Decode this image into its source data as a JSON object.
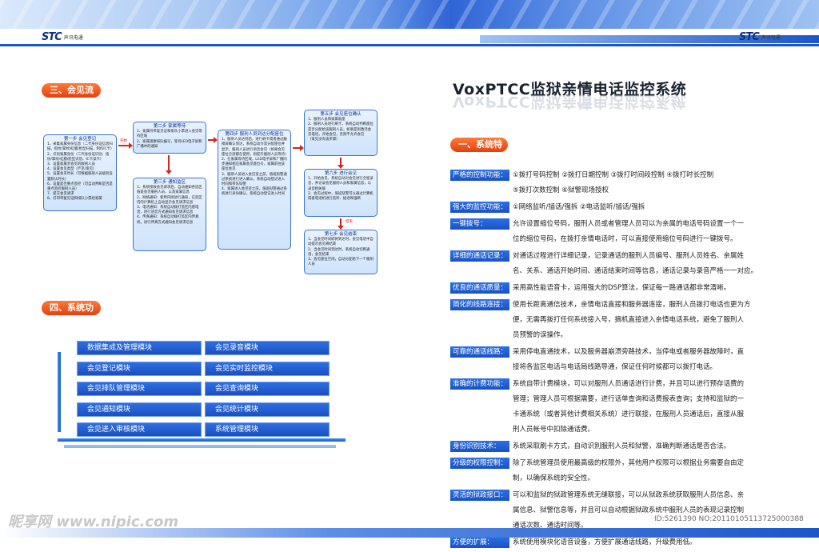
{
  "brand": {
    "logo_mark": "STC",
    "logo_text": "声讯电通"
  },
  "left": {
    "section3_title": "三、会见流程",
    "section4_title": "四、系统功能",
    "flow": {
      "step1": {
        "title": "第一步  会见登记",
        "lines": [
          "1、采集家属身份信息（二代身份证信息扫描，指纹/掌纹/虹膜/脸型扫描，制作IC卡）",
          "2、识别家属身份（二代身份证识别、指纹/掌纹/虹膜/脸型识别、IC卡读卡）",
          "3、设置家属亲会见的服刑人员",
          "4、设置会见类型（严见/宽见）",
          "5、设置会见时长（可根据服刑人员级别设置默认时长）",
          "6、设置是否重点监控（可自动判断是否是重点监控服刑人员）",
          "7、提交会见请求",
          "8、打印带复见证和排队小票给家属"
        ]
      },
      "step2": {
        "title": "第二步  家属等待",
        "lines": [
          "1、家属持带复见证和排队小票进入会见等待区域",
          "2、家属观察排队编号，等待LED电子屏和广播中的通知"
        ]
      },
      "step3": {
        "title": "第三步  通知监区",
        "lines": [
          "1、系统接收会见请求后，自动通知各监区值班会见服刑人员，以及家属信息",
          "2、网络通知：使用内网进行通知，在监区内的计算机上自动显示会见请求信息",
          "3、电话通知：系统自动拨打监区内座电话，进行语音方式通知会见请求信息",
          "4、传真通知：系统自动拨打监区内传真机，进行传真方式通知会见请求信息"
        ]
      },
      "step4": {
        "title": "第四步  服刑人员到达分配座位",
        "lines": [
          "1、服刑人员达到后，进行刷卡或者通过触摸屏确认到达，系统自动为其分配座位并显示，服刑人员进行语音会见（如果会见座位全部都在使用，则提示服刑人员等待）",
          "2、在家属等待区域，LED电子屏和广播同步通知相应家属会见座位号，家属前往该座位会见",
          "3、服刑人员进入会见室之前，值班狱警通过系统进行进入确认，系统自动登记进入时间和带队狱警",
          "4、家属进入会见室之前，值班狱警通过系统进行身份确认，系统自动登记进入时间"
        ]
      },
      "step5": {
        "title": "第五步  会见座位确认",
        "lines": [
          "1、服刑人员和家属就座",
          "2、服刑人员进行刷卡，系统自动判断座位是否分配给该服刑人员，如果是则激活会见电话，开始会见，否则不允许会见",
          "（家见没有该步骤）"
        ]
      },
      "step6": {
        "title": "第六步  进行会见",
        "lines": [
          "1、开始会见，系统自动对会见进行全程录音，并记录会见服刑人员和家属信息，与录音相关联",
          "2、会见过程中，值班狱警可以通过计算机或者电话机进行监听、插话和强断"
        ]
      },
      "step7": {
        "title": "第七步  会见结束",
        "lines": [
          "1、当会见时间即将到达时，会见电话中自动提示会见将结束",
          "2、当会见时间到达时，系统自动切断通话，会见结束",
          "3、会见座位空闲，自动分配给下一个服刑人员"
        ]
      },
      "label_start": "开始",
      "label_end": "结束"
    },
    "modules_left": [
      "数据集成及管理模块",
      "会见登记模块",
      "会见排队管理模块",
      "会见通知模块",
      "会见进入审核模块"
    ],
    "modules_right": [
      "会见录音模块",
      "会见实时监控模块",
      "会见查询模块",
      "会见统计模块",
      "系统管理模块"
    ]
  },
  "right": {
    "title": "VoxPTCC监狱亲情电话监控系统",
    "section1_title": "一、系统特点",
    "features": [
      {
        "label": "严格的控制功能：",
        "text": [
          "①拨打号码控制  ②拨打日期控制  ③拨打时间段控制  ④拨打时长控制",
          "⑤拨打次数控制  ⑥狱警现场授权"
        ]
      },
      {
        "label": "强大的监控功能：",
        "text": [
          "①网络监听/插话/强拆  ②电话监听/插话/强拆"
        ]
      },
      {
        "label": "一键拨号：",
        "text": [
          "允许设置缩位号码，服刑人员或者管理人员可以为亲属的电话号码设置一个一",
          "位的缩位号码，在拨打亲情电话时，可以直接使用缩位号码进行一键拨号。"
        ]
      },
      {
        "label": "详细的通话记录：",
        "text": [
          "对通话过程进行详细记录，记录通话的服刑人员编号、服刑人员姓名、亲属姓",
          "名、关系、通话开始时间、通话结束时间等信息，通话记录与录音严格一一对应。"
        ]
      },
      {
        "label": "优良的通话质量：",
        "text": [
          "采用高性能语音卡，运用强大的DSP算法，保证每一路通话都非常清晰。"
        ]
      },
      {
        "label": "简化的线路连接：",
        "text": [
          "使用长距离通信技术，亲情电话直接和服务器连接，服刑人员拨打电话也更为方",
          "便，无需再拨打任何系统接入号，摘机直接进入亲情电话系统，避免了服刑人",
          "员预警的误操作。"
        ]
      },
      {
        "label": "可靠的通话线路：",
        "text": [
          "采用停电直通技术，以及服务器崩溃旁路技术，当停电或者服务器故障时，直",
          "接将各监区电话与电话局线路导通，保证任何时候都可以拨打电话。"
        ]
      },
      {
        "label": "准确的计费功能：",
        "text": [
          "系统自带计费模块，可以对服刑人员通话进行计费，并且可以进行预存话费的",
          "管理；管理人员可根据需要，进行话单查询和话费报表查询；支持和监狱的一",
          "卡通系统（或者其他计费相关系统）进行联接，在服刑人员通话后，直接从服",
          "刑人员帐号中扣除通话费。"
        ]
      },
      {
        "label": "身份识别技术：",
        "text": [
          "系统采取刷卡方式，自动识别服刑人员和狱警，准确判断通话是否合法。"
        ]
      },
      {
        "label": "分级的权限控制：",
        "text": [
          "除了系统管理员使用最高级的权限外，其他用户权限可以根据业务需要自由定",
          "制，以确保系统的安全性。"
        ]
      },
      {
        "label": "灵活的狱政接口：",
        "text": [
          "可以和监狱的狱政管理系统无缝联接，可以从狱政系统获取服刑人员信息、亲",
          "属信息、狱警信息等，并且可以自动根据狱政系统中服刑人员的表现记录控制",
          "通话次数、通话时间等。"
        ]
      },
      {
        "label": "方便的扩展：",
        "text": [
          "系统使用模块化语音设备，方便扩展通话线路，升级费用低。"
        ]
      }
    ]
  },
  "footer": {
    "watermark_text": "昵享网 www.nipic.com",
    "image_id": "ID:5261390 NO:20110105113725000388"
  },
  "colors": {
    "accent_blue": "#1b56c8",
    "accent_orange": "#e2400f",
    "arrow_red": "#d8231f"
  }
}
